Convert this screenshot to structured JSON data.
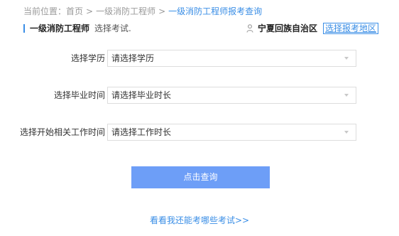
{
  "breadcrumb": {
    "prefix": "当前位置：",
    "items": [
      "首页",
      "一级消防工程师",
      "一级消防工程师报考查询"
    ],
    "separator": ">"
  },
  "header": {
    "exam_title": "一级消防工程师",
    "choose_exam": "选择考试.",
    "region_icon": "person-icon",
    "region_name": "宁夏回族自治区",
    "select_region_label": "选择报考地区"
  },
  "form": {
    "rows": [
      {
        "label": "选择学历",
        "value": "请选择学历"
      },
      {
        "label": "选择毕业时间",
        "value": "请选择毕业时长"
      },
      {
        "label": "选择开始相关工作时间",
        "value": "请选择工作时长"
      }
    ]
  },
  "query_button_label": "点击查询",
  "more_exams_link": "看看我还能考哪些考试>>",
  "colors": {
    "accent": "#3a8ee6",
    "button": "#6d9ef7",
    "border": "#dddddd"
  }
}
